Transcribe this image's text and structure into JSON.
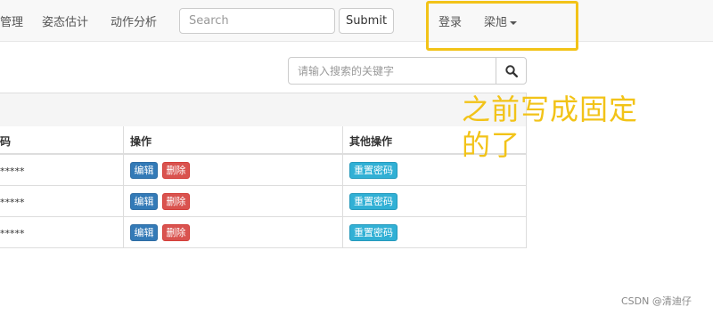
{
  "navbar": {
    "links": [
      "管理",
      "姿态估计",
      "动作分析"
    ],
    "search_placeholder": "Search",
    "submit_label": "Submit",
    "login": "登录",
    "user": "梁旭"
  },
  "keyword_search": {
    "placeholder": "请输入搜索的关键字"
  },
  "table": {
    "headers": [
      "码",
      "操作",
      "其他操作"
    ],
    "rows": [
      {
        "password": "*****",
        "edit": "编辑",
        "delete": "删除",
        "reset": "重置密码"
      },
      {
        "password": "*****",
        "edit": "编辑",
        "delete": "删除",
        "reset": "重置密码"
      },
      {
        "password": "*****",
        "edit": "编辑",
        "delete": "删除",
        "reset": "重置密码"
      }
    ]
  },
  "annotation": "之前写成固定的了",
  "footer": "CSDN @清迪仔",
  "colors": {
    "highlight": "#f2c318",
    "primary": "#337ab7",
    "danger": "#d9534f",
    "info": "#31b0d5"
  }
}
